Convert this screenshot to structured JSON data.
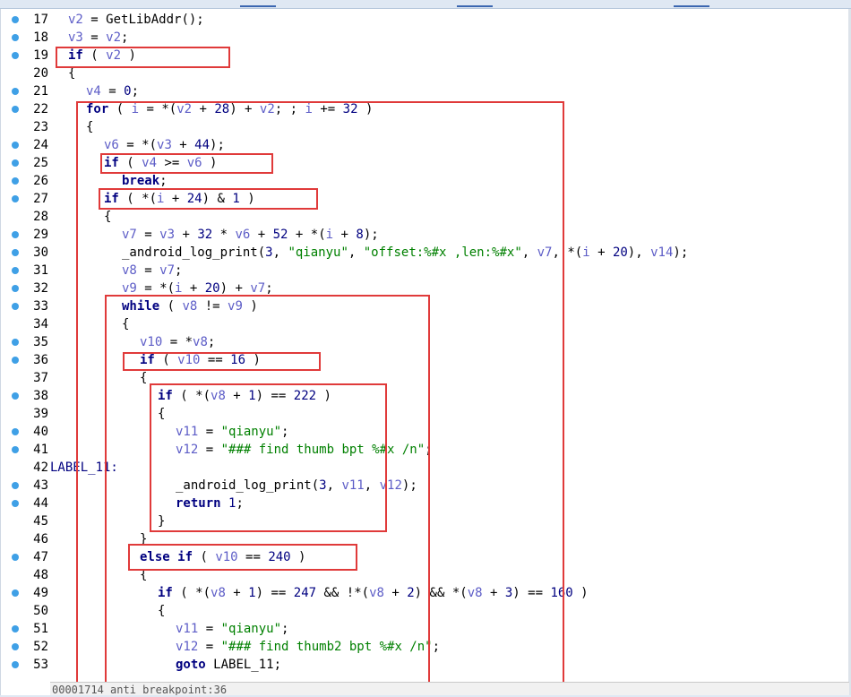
{
  "status_bar": {
    "text": "00001714 anti_breakpoint:36"
  },
  "highlight_color": "#e03a3a",
  "lines": [
    {
      "num": "17",
      "bp": true,
      "indent": 1,
      "tokens": [
        [
          "v",
          "v2"
        ],
        [
          "p",
          " = "
        ],
        [
          "f",
          "GetLibAddr"
        ],
        [
          "p",
          "();"
        ]
      ]
    },
    {
      "num": "18",
      "bp": true,
      "indent": 1,
      "tokens": [
        [
          "v",
          "v3"
        ],
        [
          "p",
          " = "
        ],
        [
          "v",
          "v2"
        ],
        [
          "p",
          ";"
        ]
      ]
    },
    {
      "num": "19",
      "bp": true,
      "indent": 1,
      "tokens": [
        [
          "k",
          "if"
        ],
        [
          "p",
          " ( "
        ],
        [
          "v",
          "v2"
        ],
        [
          "p",
          " )"
        ]
      ]
    },
    {
      "num": "20",
      "bp": false,
      "indent": 1,
      "tokens": [
        [
          "p",
          "{"
        ]
      ]
    },
    {
      "num": "21",
      "bp": true,
      "indent": 2,
      "tokens": [
        [
          "v",
          "v4"
        ],
        [
          "p",
          " = "
        ],
        [
          "n",
          "0"
        ],
        [
          "p",
          ";"
        ]
      ]
    },
    {
      "num": "22",
      "bp": true,
      "indent": 2,
      "tokens": [
        [
          "k",
          "for"
        ],
        [
          "p",
          " ( "
        ],
        [
          "v",
          "i"
        ],
        [
          "p",
          " = *("
        ],
        [
          "v",
          "v2"
        ],
        [
          "p",
          " + "
        ],
        [
          "n",
          "28"
        ],
        [
          "p",
          ") + "
        ],
        [
          "v",
          "v2"
        ],
        [
          "p",
          "; ; "
        ],
        [
          "v",
          "i"
        ],
        [
          "p",
          " += "
        ],
        [
          "n",
          "32"
        ],
        [
          "p",
          " )"
        ]
      ]
    },
    {
      "num": "23",
      "bp": false,
      "indent": 2,
      "tokens": [
        [
          "p",
          "{"
        ]
      ]
    },
    {
      "num": "24",
      "bp": true,
      "indent": 3,
      "tokens": [
        [
          "v",
          "v6"
        ],
        [
          "p",
          " = *("
        ],
        [
          "v",
          "v3"
        ],
        [
          "p",
          " + "
        ],
        [
          "n",
          "44"
        ],
        [
          "p",
          ");"
        ]
      ]
    },
    {
      "num": "25",
      "bp": true,
      "indent": 3,
      "tokens": [
        [
          "k",
          "if"
        ],
        [
          "p",
          " ( "
        ],
        [
          "v",
          "v4"
        ],
        [
          "p",
          " >= "
        ],
        [
          "v",
          "v6"
        ],
        [
          "p",
          " )"
        ]
      ]
    },
    {
      "num": "26",
      "bp": true,
      "indent": 4,
      "tokens": [
        [
          "k",
          "break"
        ],
        [
          "p",
          ";"
        ]
      ]
    },
    {
      "num": "27",
      "bp": true,
      "indent": 3,
      "tokens": [
        [
          "k",
          "if"
        ],
        [
          "p",
          " ( *("
        ],
        [
          "v",
          "i"
        ],
        [
          "p",
          " + "
        ],
        [
          "n",
          "24"
        ],
        [
          "p",
          ") & "
        ],
        [
          "n",
          "1"
        ],
        [
          "p",
          " )"
        ]
      ]
    },
    {
      "num": "28",
      "bp": false,
      "indent": 3,
      "tokens": [
        [
          "p",
          "{"
        ]
      ]
    },
    {
      "num": "29",
      "bp": true,
      "indent": 4,
      "tokens": [
        [
          "v",
          "v7"
        ],
        [
          "p",
          " = "
        ],
        [
          "v",
          "v3"
        ],
        [
          "p",
          " + "
        ],
        [
          "n",
          "32"
        ],
        [
          "p",
          " * "
        ],
        [
          "v",
          "v6"
        ],
        [
          "p",
          " + "
        ],
        [
          "n",
          "52"
        ],
        [
          "p",
          " + *("
        ],
        [
          "v",
          "i"
        ],
        [
          "p",
          " + "
        ],
        [
          "n",
          "8"
        ],
        [
          "p",
          ");"
        ]
      ]
    },
    {
      "num": "30",
      "bp": true,
      "indent": 4,
      "tokens": [
        [
          "f",
          "_android_log_print"
        ],
        [
          "p",
          "("
        ],
        [
          "n",
          "3"
        ],
        [
          "p",
          ", "
        ],
        [
          "s",
          "\"qianyu\""
        ],
        [
          "p",
          ", "
        ],
        [
          "s",
          "\"offset:%#x ,len:%#x\""
        ],
        [
          "p",
          ", "
        ],
        [
          "v",
          "v7"
        ],
        [
          "p",
          ", *("
        ],
        [
          "v",
          "i"
        ],
        [
          "p",
          " + "
        ],
        [
          "n",
          "20"
        ],
        [
          "p",
          "), "
        ],
        [
          "v",
          "v14"
        ],
        [
          "p",
          ");"
        ]
      ]
    },
    {
      "num": "31",
      "bp": true,
      "indent": 4,
      "tokens": [
        [
          "v",
          "v8"
        ],
        [
          "p",
          " = "
        ],
        [
          "v",
          "v7"
        ],
        [
          "p",
          ";"
        ]
      ]
    },
    {
      "num": "32",
      "bp": true,
      "indent": 4,
      "tokens": [
        [
          "v",
          "v9"
        ],
        [
          "p",
          " = *("
        ],
        [
          "v",
          "i"
        ],
        [
          "p",
          " + "
        ],
        [
          "n",
          "20"
        ],
        [
          "p",
          ") + "
        ],
        [
          "v",
          "v7"
        ],
        [
          "p",
          ";"
        ]
      ]
    },
    {
      "num": "33",
      "bp": true,
      "indent": 4,
      "tokens": [
        [
          "k",
          "while"
        ],
        [
          "p",
          " ( "
        ],
        [
          "v",
          "v8"
        ],
        [
          "p",
          " != "
        ],
        [
          "v",
          "v9"
        ],
        [
          "p",
          " )"
        ]
      ]
    },
    {
      "num": "34",
      "bp": false,
      "indent": 4,
      "tokens": [
        [
          "p",
          "{"
        ]
      ]
    },
    {
      "num": "35",
      "bp": true,
      "indent": 5,
      "tokens": [
        [
          "v",
          "v10"
        ],
        [
          "p",
          " = *"
        ],
        [
          "v",
          "v8"
        ],
        [
          "p",
          ";"
        ]
      ]
    },
    {
      "num": "36",
      "bp": true,
      "indent": 5,
      "tokens": [
        [
          "k",
          "if"
        ],
        [
          "p",
          " ( "
        ],
        [
          "v",
          "v10"
        ],
        [
          "p",
          " == "
        ],
        [
          "n",
          "16"
        ],
        [
          "p",
          " )"
        ]
      ]
    },
    {
      "num": "37",
      "bp": false,
      "indent": 5,
      "tokens": [
        [
          "p",
          "{"
        ]
      ]
    },
    {
      "num": "38",
      "bp": true,
      "indent": 6,
      "tokens": [
        [
          "k",
          "if"
        ],
        [
          "p",
          " ( *("
        ],
        [
          "v",
          "v8"
        ],
        [
          "p",
          " + "
        ],
        [
          "n",
          "1"
        ],
        [
          "p",
          ") == "
        ],
        [
          "n",
          "222"
        ],
        [
          "p",
          " )"
        ]
      ]
    },
    {
      "num": "39",
      "bp": false,
      "indent": 6,
      "tokens": [
        [
          "p",
          "{"
        ]
      ]
    },
    {
      "num": "40",
      "bp": true,
      "indent": 7,
      "tokens": [
        [
          "v",
          "v11"
        ],
        [
          "p",
          " = "
        ],
        [
          "s",
          "\"qianyu\""
        ],
        [
          "p",
          ";"
        ]
      ]
    },
    {
      "num": "41",
      "bp": true,
      "indent": 7,
      "tokens": [
        [
          "v",
          "v12"
        ],
        [
          "p",
          " = "
        ],
        [
          "s",
          "\"### find thumb bpt %#x /n\""
        ],
        [
          "p",
          ";"
        ]
      ]
    },
    {
      "num": "42",
      "bp": false,
      "indent": 0,
      "label": "LABEL_11:",
      "tokens": []
    },
    {
      "num": "43",
      "bp": true,
      "indent": 7,
      "tokens": [
        [
          "f",
          "_android_log_print"
        ],
        [
          "p",
          "("
        ],
        [
          "n",
          "3"
        ],
        [
          "p",
          ", "
        ],
        [
          "v",
          "v11"
        ],
        [
          "p",
          ", "
        ],
        [
          "v",
          "v12"
        ],
        [
          "p",
          ");"
        ]
      ]
    },
    {
      "num": "44",
      "bp": true,
      "indent": 7,
      "tokens": [
        [
          "k",
          "return"
        ],
        [
          "p",
          " "
        ],
        [
          "n",
          "1"
        ],
        [
          "p",
          ";"
        ]
      ]
    },
    {
      "num": "45",
      "bp": false,
      "indent": 6,
      "tokens": [
        [
          "p",
          "}"
        ]
      ]
    },
    {
      "num": "46",
      "bp": false,
      "indent": 5,
      "tokens": [
        [
          "p",
          "}"
        ]
      ]
    },
    {
      "num": "47",
      "bp": true,
      "indent": 5,
      "tokens": [
        [
          "k",
          "else if"
        ],
        [
          "p",
          " ( "
        ],
        [
          "v",
          "v10"
        ],
        [
          "p",
          " == "
        ],
        [
          "n",
          "240"
        ],
        [
          "p",
          " )"
        ]
      ]
    },
    {
      "num": "48",
      "bp": false,
      "indent": 5,
      "tokens": [
        [
          "p",
          "{"
        ]
      ]
    },
    {
      "num": "49",
      "bp": true,
      "indent": 6,
      "tokens": [
        [
          "k",
          "if"
        ],
        [
          "p",
          " ( *("
        ],
        [
          "v",
          "v8"
        ],
        [
          "p",
          " + "
        ],
        [
          "n",
          "1"
        ],
        [
          "p",
          ") == "
        ],
        [
          "n",
          "247"
        ],
        [
          "p",
          " && !*("
        ],
        [
          "v",
          "v8"
        ],
        [
          "p",
          " + "
        ],
        [
          "n",
          "2"
        ],
        [
          "p",
          ") && *("
        ],
        [
          "v",
          "v8"
        ],
        [
          "p",
          " + "
        ],
        [
          "n",
          "3"
        ],
        [
          "p",
          ") == "
        ],
        [
          "n",
          "160"
        ],
        [
          "p",
          " )"
        ]
      ]
    },
    {
      "num": "50",
      "bp": false,
      "indent": 6,
      "tokens": [
        [
          "p",
          "{"
        ]
      ]
    },
    {
      "num": "51",
      "bp": true,
      "indent": 7,
      "tokens": [
        [
          "v",
          "v11"
        ],
        [
          "p",
          " = "
        ],
        [
          "s",
          "\"qianyu\""
        ],
        [
          "p",
          ";"
        ]
      ]
    },
    {
      "num": "52",
      "bp": true,
      "indent": 7,
      "tokens": [
        [
          "v",
          "v12"
        ],
        [
          "p",
          " = "
        ],
        [
          "s",
          "\"### find thumb2 bpt %#x /n\""
        ],
        [
          "p",
          ";"
        ]
      ]
    },
    {
      "num": "53",
      "bp": true,
      "indent": 7,
      "tokens": [
        [
          "k",
          "goto"
        ],
        [
          "p",
          " "
        ],
        [
          "f",
          "LABEL_11"
        ],
        [
          "p",
          ";"
        ]
      ]
    }
  ]
}
